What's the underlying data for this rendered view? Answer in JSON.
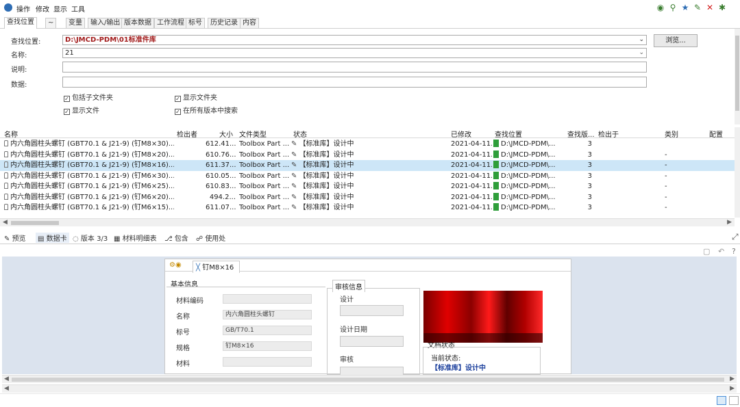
{
  "menu": {
    "items": [
      "操作",
      "修改",
      "显示",
      "工具"
    ]
  },
  "toolbar_icons": [
    "find-user-icon",
    "search-user-icon",
    "star-icon",
    "edit-icon",
    "close-icon",
    "settings-icon"
  ],
  "tabs": [
    "查找位置",
    "~",
    "变量",
    "输入/输出",
    "版本数据",
    "工作流程",
    "标号",
    "历史记录",
    "内容"
  ],
  "form": {
    "location_label": "查找位置:",
    "location_value": "D:\\JMCD-PDM\\01标准件库",
    "browse_label": "浏览...",
    "name_label": "名称:",
    "name_value": "21",
    "desc_label": "说明:",
    "data_label": "数据:",
    "chk_subfolders": "包括子文件夹",
    "chk_show_files": "显示文件",
    "chk_show_folders": "显示文件夹",
    "chk_all_versions": "在所有版本中搜索"
  },
  "grid": {
    "headers": [
      "名称",
      "检出者",
      "大小",
      "文件类型",
      "状态",
      "已修改",
      "查找位置",
      "查找版...",
      "检出于",
      "类别",
      "配置"
    ],
    "rows": [
      {
        "name": "内六角圆柱头螺钉 (GBT70.1 & J21-9) (钉M8×30)...",
        "size": "612.41...",
        "type": "Toolbox Part ...",
        "state": "【标准库】设计中",
        "modified": "2021-04-11...",
        "location": "D:\\JMCD-PDM\\...",
        "version": "3",
        "category": "",
        "selected": false
      },
      {
        "name": "内六角圆柱头螺钉 (GBT70.1 & J21-9) (钉M8×20)...",
        "size": "610.76...",
        "type": "Toolbox Part ...",
        "state": "【标准库】设计中",
        "modified": "2021-04-11...",
        "location": "D:\\JMCD-PDM\\...",
        "version": "3",
        "category": "-",
        "selected": false
      },
      {
        "name": "内六角圆柱头螺钉 (GBT70.1 & J21-9) (钉M8×16)...",
        "size": "611.37...",
        "type": "Toolbox Part ...",
        "state": "【标准库】设计中",
        "modified": "2021-04-11...",
        "location": "D:\\JMCD-PDM\\...",
        "version": "3",
        "category": "-",
        "selected": true
      },
      {
        "name": "内六角圆柱头螺钉 (GBT70.1 & J21-9) (钉M6×30)...",
        "size": "610.05...",
        "type": "Toolbox Part ...",
        "state": "【标准库】设计中",
        "modified": "2021-04-11...",
        "location": "D:\\JMCD-PDM\\...",
        "version": "3",
        "category": "-",
        "selected": false
      },
      {
        "name": "内六角圆柱头螺钉 (GBT70.1 & J21-9) (钉M6×25)...",
        "size": "610.83...",
        "type": "Toolbox Part ...",
        "state": "【标准库】设计中",
        "modified": "2021-04-11...",
        "location": "D:\\JMCD-PDM\\...",
        "version": "3",
        "category": "-",
        "selected": false
      },
      {
        "name": "内六角圆柱头螺钉 (GBT70.1 & J21-9) (钉M6×20)...",
        "size": "494.2...",
        "type": "Toolbox Part ...",
        "state": "【标准库】设计中",
        "modified": "2021-04-11...",
        "location": "D:\\JMCD-PDM\\...",
        "version": "3",
        "category": "-",
        "selected": false
      },
      {
        "name": "内六角圆柱头螺钉 (GBT70.1 & J21-9) (钉M6×15)...",
        "size": "611.07...",
        "type": "Toolbox Part ...",
        "state": "【标准库】设计中",
        "modified": "2021-04-11...",
        "location": "D:\\JMCD-PDM\\...",
        "version": "3",
        "category": "-",
        "selected": false
      }
    ]
  },
  "bottom_tabs": [
    "预览",
    "数据卡",
    "版本 3/3",
    "材料明细表",
    "包含",
    "使用处"
  ],
  "card": {
    "tab_label": "钉M8×16",
    "basic_info_title": "基本信息",
    "fields": [
      {
        "label": "材料编码",
        "value": ""
      },
      {
        "label": "名称",
        "value": "内六角圆柱头螺钉"
      },
      {
        "label": "标号",
        "value": "GB/T70.1"
      },
      {
        "label": "规格",
        "value": "钉M8×16"
      },
      {
        "label": "材料",
        "value": ""
      }
    ],
    "review_title": "审核信息",
    "review_fields": [
      "设计",
      "设计日期",
      "审核"
    ],
    "doc_status_title": "文档状态",
    "current_status_label": "当前状态:",
    "current_status_value": "【标准库】设计中"
  }
}
